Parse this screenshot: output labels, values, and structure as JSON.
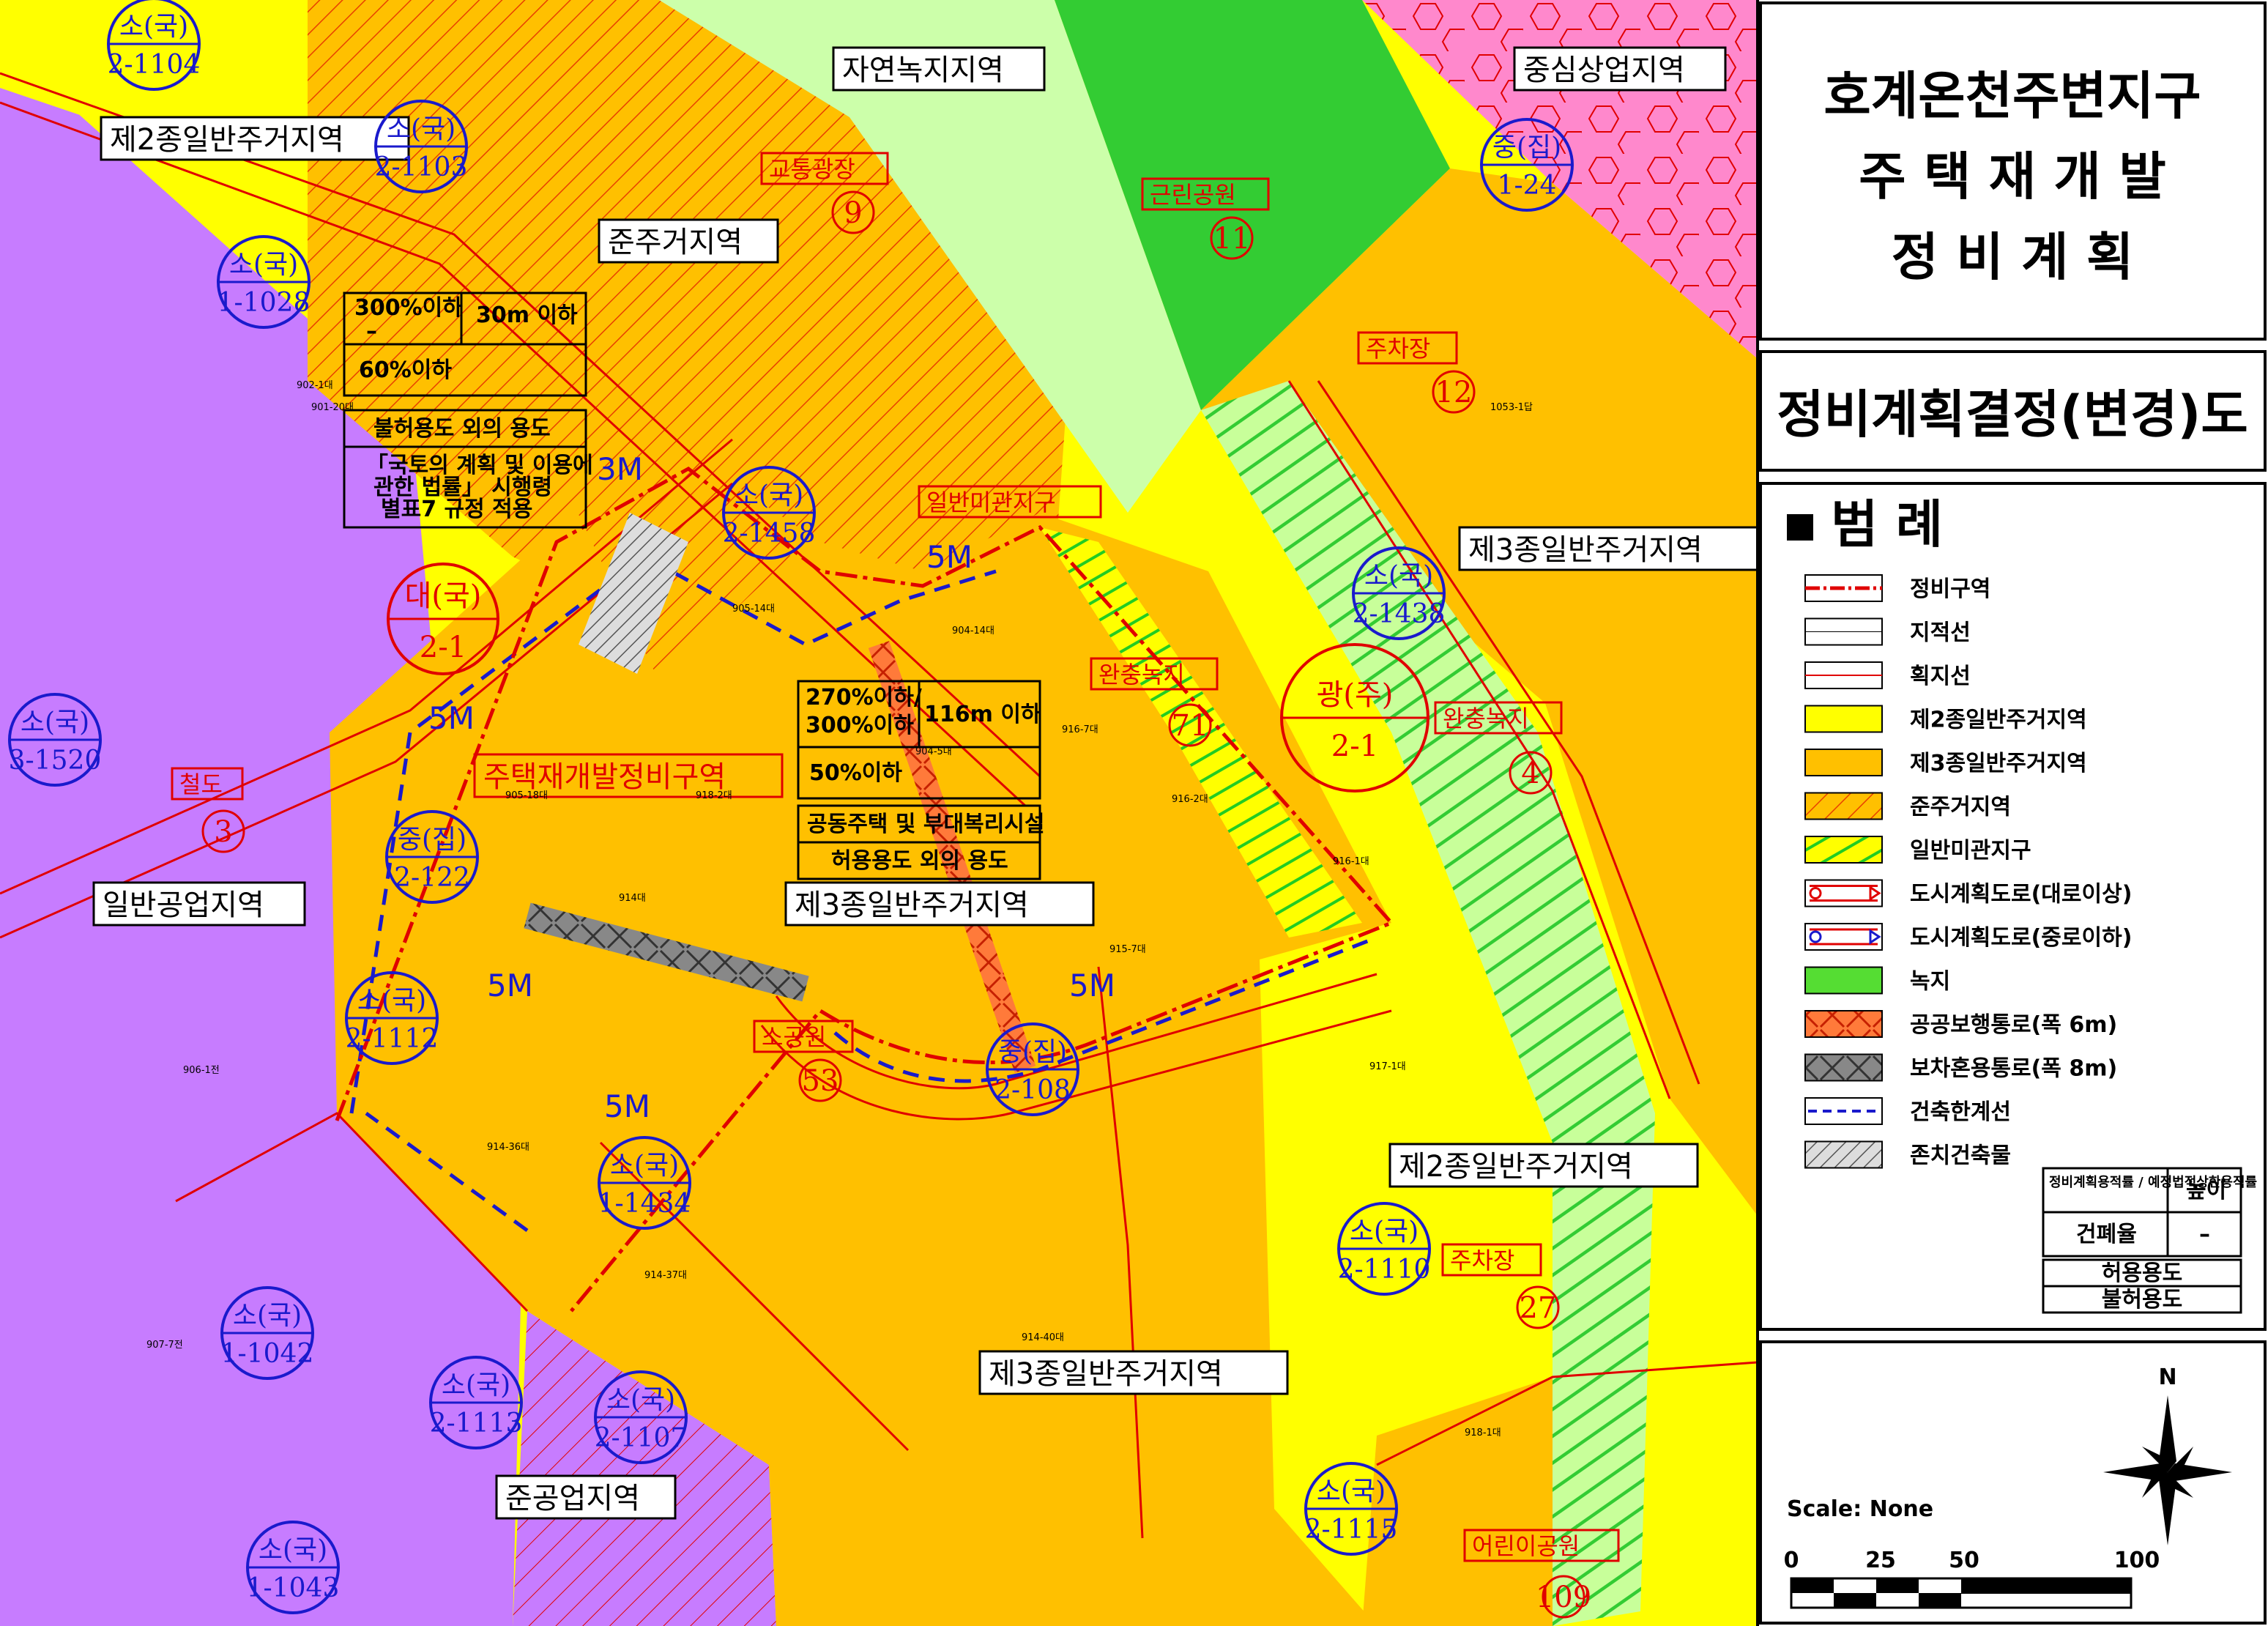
{
  "panel": {
    "title_lines": [
      "호계온천주변지구",
      "주 택 재 개 발",
      "정 비 계 획"
    ],
    "subtitle": "정비계획결정(변경)도",
    "legend_title": "범  례",
    "legend_items": [
      {
        "label": "정비구역",
        "swatch": "district"
      },
      {
        "label": "지적선",
        "swatch": "cadastral"
      },
      {
        "label": "획지선",
        "swatch": "lot"
      },
      {
        "label": "제2종일반주거지역",
        "swatch": "yellow"
      },
      {
        "label": "제3종일반주거지역",
        "swatch": "orange"
      },
      {
        "label": "준주거지역",
        "swatch": "orange-hatch"
      },
      {
        "label": "일반미관지구",
        "swatch": "green-hatch"
      },
      {
        "label": "도시계획도로(대로이상)",
        "swatch": "road-large"
      },
      {
        "label": "도시계획도로(중로이하)",
        "swatch": "road-medium"
      },
      {
        "label": "녹지",
        "swatch": "green"
      },
      {
        "label": "공공보행통로(폭 6m)",
        "swatch": "ped"
      },
      {
        "label": "보차혼용통로(폭 8m)",
        "swatch": "mixed"
      },
      {
        "label": "건축한계선",
        "swatch": "setback"
      },
      {
        "label": "존치건축물",
        "swatch": "retained"
      }
    ],
    "key_table": {
      "far": "정비계획용적률 / 예정법적상한용적률",
      "height": "높이",
      "coverage": "건폐율",
      "dash": "–",
      "allowed": "허용용도",
      "prohibited": "불허용도"
    },
    "scale_text": "Scale: None",
    "scale_ticks": [
      "0",
      "25",
      "50",
      "100"
    ],
    "north": "N"
  },
  "map": {
    "zone_labels": {
      "z_natural_green": "자연녹지지역",
      "z_central_commercial": "중심상업지역",
      "z_res2_top": "제2종일반주거지역",
      "z_semi_res": "준주거지역",
      "z_res3_right": "제3종일반주거지역",
      "z_general_industrial": "일반공업지역",
      "z_redev_district": "주택재개발정비구역",
      "z_res3_center": "제3종일반주거지역",
      "z_res3_bottom": "제3종일반주거지역",
      "z_res2_bottom": "제2종일반주거지역",
      "z_semi_industrial": "준공업지역"
    },
    "facility_labels": {
      "f_traffic_square": "교통광장",
      "f_neighborhood_park": "근린공원",
      "f_parking_top": "주차장",
      "f_scenic_district": "일반미관지구",
      "f_buffer_green_a": "완충녹지",
      "f_buffer_green_b": "완충녹지",
      "f_railway": "철도",
      "f_parking_bottom": "주차장",
      "f_children_park": "어린이공원",
      "f_small_park": "소공원"
    },
    "facility_numbers": {
      "n9": "9",
      "n11": "11",
      "n12": "12",
      "n71": "71",
      "n4": "4",
      "n3": "3",
      "n53": "53",
      "n27": "27",
      "n109": "109"
    },
    "road_tags": {
      "r_1104": [
        "소(국)",
        "2-1104"
      ],
      "r_1103": [
        "소(국)",
        "2-1103"
      ],
      "r_1028": [
        "소(국)",
        "1-1028"
      ],
      "r_1458": [
        "소(국)",
        "2-1458"
      ],
      "r_124": [
        "중(집)",
        "1-24"
      ],
      "r_1438": [
        "소(국)",
        "2-1438"
      ],
      "r_1520": [
        "소(국)",
        "3-1520"
      ],
      "r_122": [
        "중(집)",
        "2-122"
      ],
      "r_1112": [
        "소(국)",
        "2-1112"
      ],
      "r_1434": [
        "소(국)",
        "1-1434"
      ],
      "r_108": [
        "중(집)",
        "2-108"
      ],
      "r_1110": [
        "소(국)",
        "2-1110"
      ],
      "r_1042": [
        "소(국)",
        "1-1042"
      ],
      "r_1113": [
        "소(국)",
        "2-1113"
      ],
      "r_1107": [
        "소(국)",
        "2-1107"
      ],
      "r_1115": [
        "소(국)",
        "2-1115"
      ],
      "r_1043": [
        "소(국)",
        "1-1043"
      ]
    },
    "big_roads": {
      "b_21": [
        "대(국)",
        "2-1"
      ],
      "b_wide": [
        "광(주)",
        "2-1"
      ]
    },
    "setbacks": {
      "s1": "3M",
      "s2": "5M",
      "s3": "5M",
      "s4": "5M",
      "s5": "5M",
      "s6": "5M"
    },
    "semi_res_info": {
      "far": "300%이하",
      "dash": "–",
      "height": "30m 이하",
      "coverage": "60%이하",
      "prohibited_label": "불허용도 외의 용도",
      "rule": [
        "「국토의 계획 및 이용에",
        "관한 법률」 시행령",
        "별표7 규정 적용"
      ]
    },
    "res3_info": {
      "far": [
        "270%이하/",
        "300%이하"
      ],
      "height": "116m 이하",
      "coverage": "50%이하",
      "use": "공동주택 및 부대복리시설",
      "allowed_label": "허용용도 외의 용도"
    },
    "parcels": [
      {
        "id": "p1",
        "text": "905-14대"
      },
      {
        "id": "p2",
        "text": "904-14대"
      },
      {
        "id": "p3",
        "text": "916-2대"
      },
      {
        "id": "p4",
        "text": "914대"
      },
      {
        "id": "p5",
        "text": "915-7대"
      },
      {
        "id": "p6",
        "text": "914-36대"
      },
      {
        "id": "p7",
        "text": "914-40대"
      },
      {
        "id": "p8",
        "text": "918-2대"
      },
      {
        "id": "p9",
        "text": "905-18대"
      },
      {
        "id": "p10",
        "text": "916-1대"
      },
      {
        "id": "p11",
        "text": "904-5대"
      },
      {
        "id": "p12",
        "text": "906-1전"
      },
      {
        "id": "p13",
        "text": "907-7전"
      },
      {
        "id": "p14",
        "text": "917-1대"
      },
      {
        "id": "p15",
        "text": "918-1대"
      },
      {
        "id": "p16",
        "text": "902-1대"
      },
      {
        "id": "p17",
        "text": "901-20대"
      },
      {
        "id": "p18",
        "text": "914-37대"
      },
      {
        "id": "p19",
        "text": "916-7대"
      },
      {
        "id": "p20",
        "text": "1053-1답"
      }
    ]
  }
}
